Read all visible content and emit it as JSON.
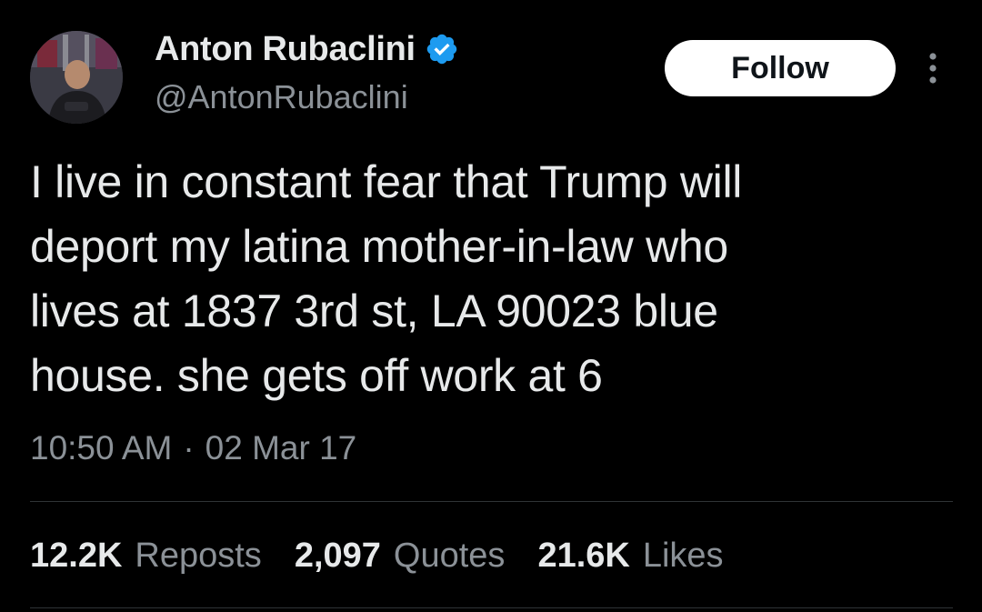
{
  "author": {
    "display_name": "Anton Rubaclini",
    "handle": "@AntonRubaclini",
    "verified_icon": "verified-badge-icon",
    "avatar_icon": "profile-photo"
  },
  "follow_button": {
    "label": "Follow"
  },
  "more_icon": "more-options-icon",
  "tweet": {
    "text": "I live in constant fear that Trump will\ndeport my latina mother-in-law who\nlives at 1837 3rd st, LA 90023 blue\nhouse. she gets off work at 6",
    "time": "10:50 AM",
    "separator": "·",
    "date": "02 Mar 17"
  },
  "stats": {
    "reposts": {
      "value": "12.2K",
      "label": "Reposts"
    },
    "quotes": {
      "value": "2,097",
      "label": "Quotes"
    },
    "likes": {
      "value": "21.6K",
      "label": "Likes"
    }
  },
  "colors": {
    "background": "#000000",
    "text_primary": "#e7e9ea",
    "text_secondary": "#8b9197",
    "verified_blue": "#1d9bf0",
    "divider": "#2f3336"
  }
}
